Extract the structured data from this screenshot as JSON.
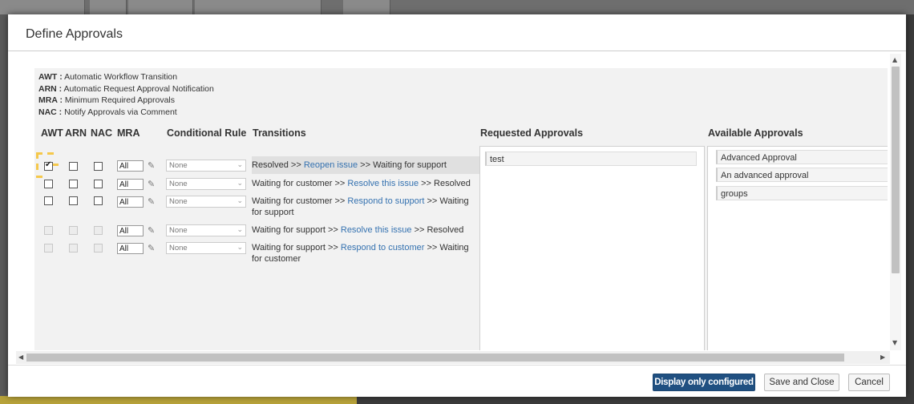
{
  "dialog": {
    "title": "Define Approvals"
  },
  "legend": [
    {
      "key": "AWT :",
      "desc": " Automatic Workflow Transition"
    },
    {
      "key": "ARN :",
      "desc": " Automatic Request Approval Notification"
    },
    {
      "key": "MRA :",
      "desc": " Minimum Required Approvals"
    },
    {
      "key": "NAC :",
      "desc": " Notify Approvals via Comment"
    }
  ],
  "columns": {
    "awt": "AWT",
    "arn": "ARN",
    "nac": "NAC",
    "mra": "MRA",
    "conditional_rule": "Conditional Rule",
    "transitions": "Transitions",
    "requested": "Requested Approvals",
    "available": "Available Approvals"
  },
  "rows": [
    {
      "awt": true,
      "enabled": true,
      "mra": "All",
      "rule": "None",
      "from": "Resolved >> ",
      "link": "Reopen issue",
      "to": " >> Waiting for support"
    },
    {
      "awt": false,
      "enabled": true,
      "mra": "All",
      "rule": "None",
      "from": "Waiting for customer >> ",
      "link": "Resolve this issue",
      "to": " >> Resolved"
    },
    {
      "awt": false,
      "enabled": true,
      "mra": "All",
      "rule": "None",
      "from": "Waiting for customer >> ",
      "link": "Respond to support",
      "to": " >> Waiting for support"
    },
    {
      "awt": false,
      "enabled": false,
      "mra": "All",
      "rule": "None",
      "from": "Waiting for support >> ",
      "link": "Resolve this issue",
      "to": " >> Resolved"
    },
    {
      "awt": false,
      "enabled": false,
      "mra": "All",
      "rule": "None",
      "from": "Waiting for support >> ",
      "link": "Respond to customer",
      "to": " >> Waiting for customer"
    }
  ],
  "requested_approvals": [
    "test"
  ],
  "available_approvals": [
    "Advanced Approval",
    "An advanced approval",
    "groups"
  ],
  "footer": {
    "display_only_configured": "Display only configured",
    "save_and_close": "Save and Close",
    "cancel": "Cancel"
  },
  "colors": {
    "primary": "#205081",
    "link": "#3572b0",
    "highlight": "#f5c84b"
  }
}
